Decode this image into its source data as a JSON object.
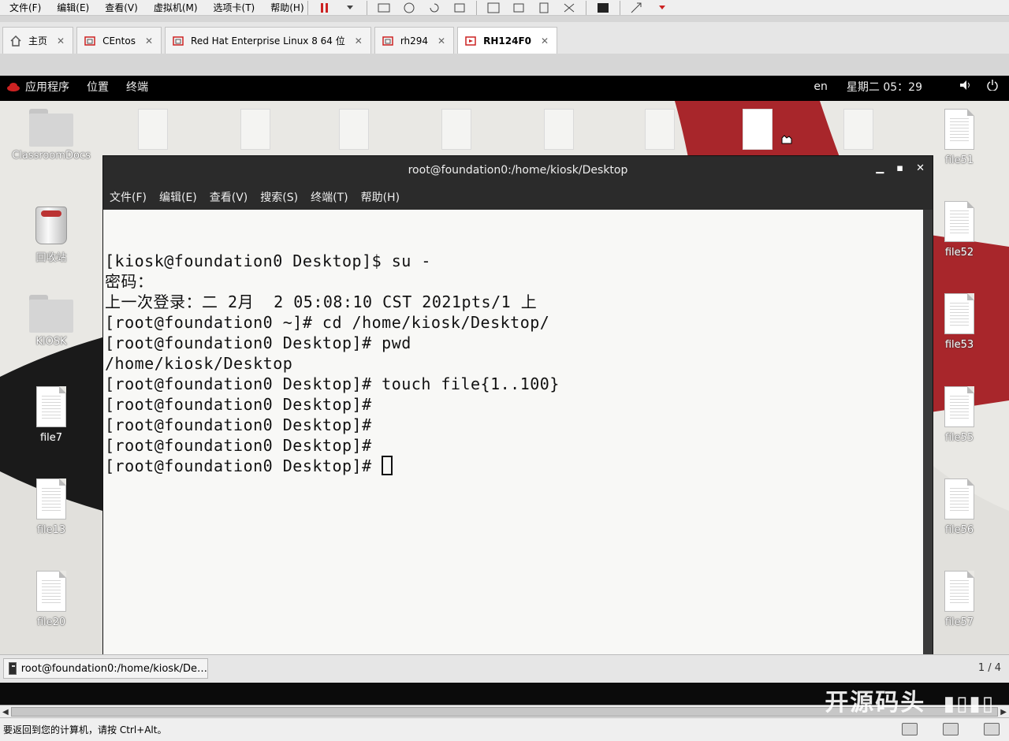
{
  "vm": {
    "menus": [
      "文件(F)",
      "编辑(E)",
      "查看(V)",
      "虚拟机(M)",
      "选项卡(T)",
      "帮助(H)"
    ],
    "tabs": [
      {
        "label": "主页",
        "icon": "home-icon"
      },
      {
        "label": "CEntos",
        "icon": "vm-icon"
      },
      {
        "label": "Red Hat Enterprise Linux 8 64 位",
        "icon": "vm-icon"
      },
      {
        "label": "rh294",
        "icon": "vm-icon"
      },
      {
        "label": "RH124F0",
        "icon": "vm-running-icon",
        "active": true
      }
    ]
  },
  "gnome": {
    "menus": [
      "应用程序",
      "位置",
      "终端"
    ],
    "lang": "en",
    "clock": "星期二 05：29"
  },
  "desktop": {
    "left_icons": [
      {
        "label": "ClassroomDocs",
        "type": "folder"
      },
      {
        "label": "回收站",
        "type": "trash"
      },
      {
        "label": "KIOSK",
        "type": "folder"
      },
      {
        "label": "file7",
        "type": "file"
      },
      {
        "label": "file13",
        "type": "file"
      },
      {
        "label": "file20",
        "type": "file"
      }
    ],
    "right_icons": [
      {
        "label": "file51"
      },
      {
        "label": "file52"
      },
      {
        "label": "file53"
      },
      {
        "label": "file55"
      },
      {
        "label": "file56"
      },
      {
        "label": "file57"
      }
    ]
  },
  "terminal": {
    "title": "root@foundation0:/home/kiosk/Desktop",
    "menus": [
      "文件(F)",
      "编辑(E)",
      "查看(V)",
      "搜索(S)",
      "终端(T)",
      "帮助(H)"
    ],
    "lines": [
      "[kiosk@foundation0 Desktop]$ su -",
      "密码：",
      "上一次登录：二 2月  2 05:08:10 CST 2021pts/1 上",
      "[root@foundation0 ~]# cd /home/kiosk/Desktop/",
      "[root@foundation0 Desktop]# pwd",
      "/home/kiosk/Desktop",
      "[root@foundation0 Desktop]# touch file{1..100}",
      "[root@foundation0 Desktop]#",
      "[root@foundation0 Desktop]#",
      "[root@foundation0 Desktop]#"
    ],
    "prompt": "[root@foundation0 Desktop]# "
  },
  "taskbar": {
    "item": "root@foundation0:/home/kiosk/De…",
    "workspace": "1 / 4"
  },
  "watermark": "开源码头",
  "status": {
    "text": "要返回到您的计算机，请按 Ctrl+Alt。"
  },
  "colors": {
    "accent_red": "#a8262b",
    "terminal_bg": "#f8f8f6",
    "terminal_chrome": "#2b2b2b"
  }
}
